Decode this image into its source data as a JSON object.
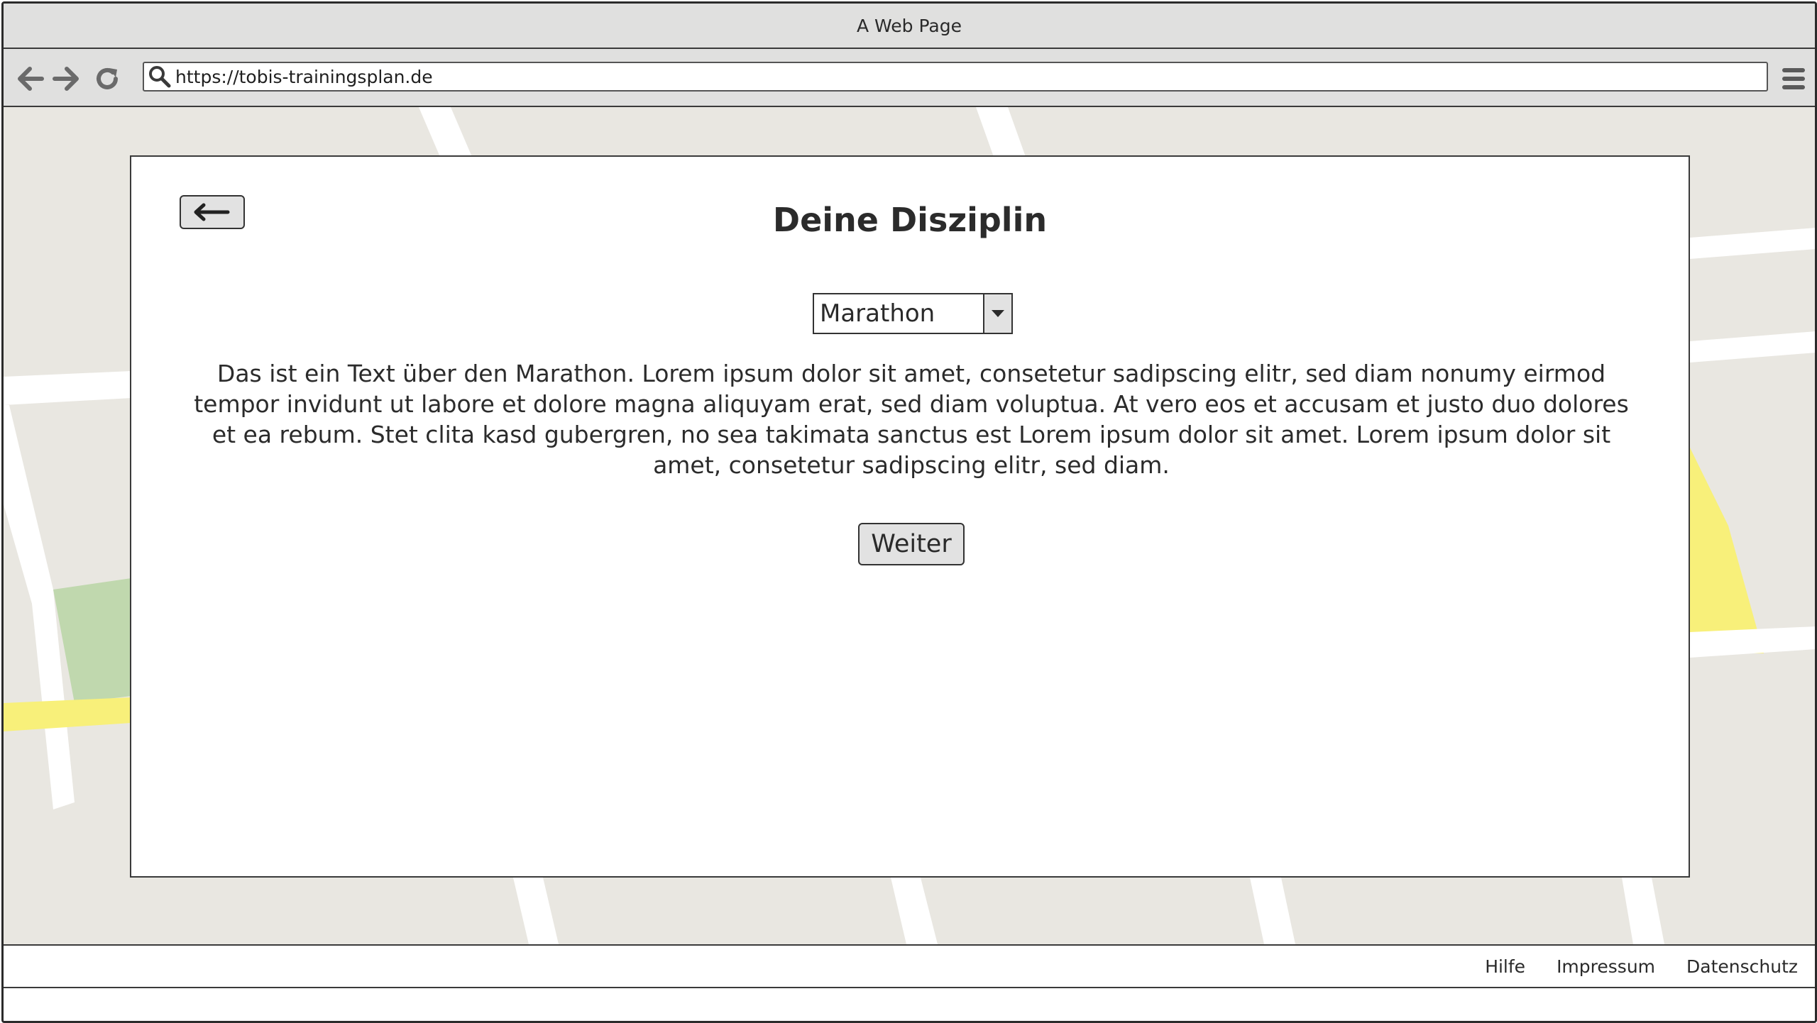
{
  "window": {
    "title": "A Web Page"
  },
  "toolbar": {
    "back_icon": "arrow-left-icon",
    "forward_icon": "arrow-right-icon",
    "reload_icon": "reload-icon",
    "url": "https://tobis-trainingsplan.de",
    "search_icon": "search-icon",
    "menu_icon": "hamburger-menu-icon"
  },
  "main": {
    "back_button_icon": "arrow-left-icon",
    "title": "Deine Disziplin",
    "discipline_select": {
      "selected": "Marathon"
    },
    "description": "Das ist ein Text über den Marathon. Lorem ipsum dolor sit amet, consetetur sadipscing elitr, sed diam nonumy eirmod tempor invidunt ut labore et dolore magna aliquyam erat, sed diam voluptua. At vero eos et accusam et justo duo dolores et ea rebum. Stet clita kasd gubergren, no sea takimata sanctus est Lorem ipsum dolor sit amet. Lorem ipsum dolor sit amet, consetetur sadipscing elitr, sed diam.",
    "next_button": "Weiter"
  },
  "footer": {
    "links": [
      "Hilfe",
      "Impressum",
      "Datenschutz"
    ]
  },
  "colors": {
    "chrome": "#e0e0df",
    "map_background": "#e9e7e1",
    "map_park": "#c0d8ae",
    "map_highway": "#f8f07a",
    "button": "#e2e2e2"
  }
}
